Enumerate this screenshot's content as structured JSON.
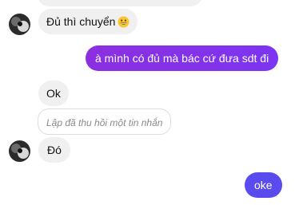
{
  "colors": {
    "outgoing_bubble": "#8a2be2",
    "outgoing_bubble_oke": "#5a4bef",
    "incoming_bubble": "#f0f0f0",
    "recalled_border": "#dddddd",
    "recalled_text": "#8a8a8a"
  },
  "messages": [
    {
      "sender": "contact",
      "text": "Đủ thì chuyển",
      "icon": "grinning-emoji-icon"
    },
    {
      "sender": "me",
      "text": "à mình có đủ mà bác cứ đưa sdt đi"
    },
    {
      "sender": "contact",
      "text": "Ok"
    },
    {
      "sender": "contact",
      "text": "Lập đã thu hồi một tin nhắn",
      "recalled": true
    },
    {
      "sender": "contact",
      "text": "Đó"
    },
    {
      "sender": "me",
      "text": "oke"
    }
  ]
}
